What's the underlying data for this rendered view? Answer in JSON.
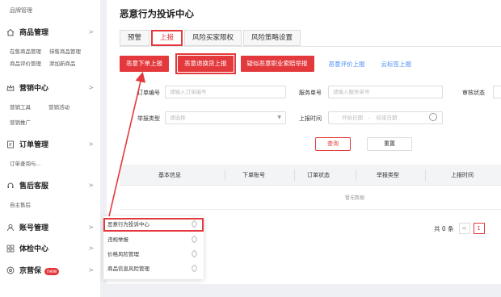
{
  "sidebar": {
    "top_link": "品牌管理",
    "groups": [
      {
        "label": "商品管理",
        "subs": [
          "在售商品管理",
          "待售商品管理",
          "商品评价管理",
          "添加新商品"
        ]
      },
      {
        "label": "营销中心",
        "subs": [
          "营销工具",
          "营销活动",
          "营销推广"
        ]
      },
      {
        "label": "订单管理",
        "subs": [
          "订单查询与..."
        ]
      },
      {
        "label": "售后客服",
        "subs": [
          "自主售后"
        ]
      },
      {
        "label": "账号管理",
        "subs": []
      },
      {
        "label": "体检中心",
        "subs": []
      },
      {
        "label": "京营保",
        "badge": "new",
        "subs": []
      }
    ]
  },
  "page": {
    "title": "恶意行为投诉中心",
    "tabs": [
      "预警",
      "上报",
      "风险买家限权",
      "风险策略设置"
    ],
    "active_tab": "上报"
  },
  "actions": {
    "buttons": [
      "恶意下单上报",
      "恶意退换货上报",
      "疑似恶意职业索赔举报"
    ],
    "links": [
      "恶意评价上报",
      "云标签上报"
    ]
  },
  "form": {
    "order_no_label": "订单编号",
    "order_no_placeholder": "请输入订单编号",
    "service_no_label": "服务单号",
    "service_no_placeholder": "请输入服务单号",
    "review_status_label": "审核状态",
    "report_type_label": "举报类型",
    "report_type_placeholder": "请选择",
    "report_time_label": "上报时间",
    "start_date": "开始日期",
    "date_sep": "-",
    "end_date": "结束日期",
    "query_btn": "查询",
    "reset_btn": "重置"
  },
  "table": {
    "columns": [
      "基本信息",
      "下单账号",
      "订单状态",
      "举报类型",
      "上报时间"
    ],
    "empty_text": "暂无数据"
  },
  "pager": {
    "total": "共 0 条",
    "prev": "<",
    "current": "1"
  },
  "flyout": {
    "items": [
      "恶意行为投诉中心",
      "违规举报",
      "价格风险管理",
      "商品信息风险管理"
    ]
  },
  "colors": {
    "accent": "#e4393c",
    "link": "#4a8ef5"
  }
}
